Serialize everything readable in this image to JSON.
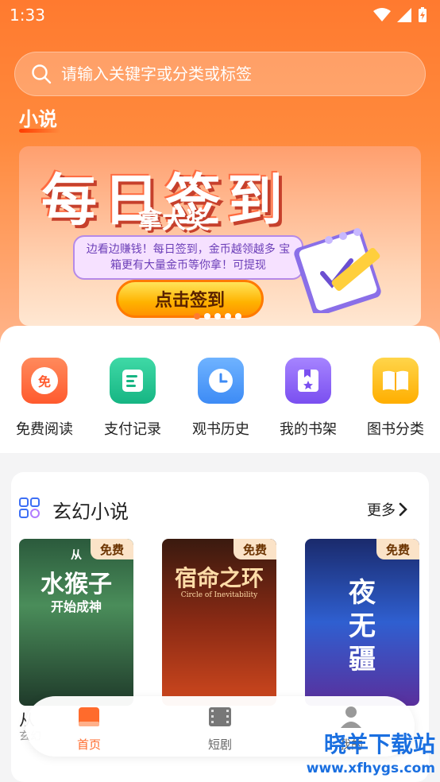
{
  "status_bar": {
    "time": "1:33"
  },
  "search": {
    "placeholder": "请输入关键字或分类或标签"
  },
  "section_tab": "小说",
  "banner": {
    "title": "每日签到",
    "subtitle": "拿大奖",
    "description": "边看边赚钱！每日签到，金币越领越多 宝箱更有大量金币等你拿！可提现",
    "button": "点击签到",
    "slides": 5,
    "active_slide": 1
  },
  "quick_menu": [
    {
      "label": "免费阅读",
      "icon": "free-icon",
      "color": "#ff6b3d",
      "glyph": "免"
    },
    {
      "label": "支付记录",
      "icon": "payment-record-icon",
      "color": "#1bbd8c"
    },
    {
      "label": "观书历史",
      "icon": "history-clock-icon",
      "color": "#4a9bff"
    },
    {
      "label": "我的书架",
      "icon": "bookshelf-icon",
      "color": "#8a5cff"
    },
    {
      "label": "图书分类",
      "icon": "book-category-icon",
      "color": "#ffb300"
    }
  ],
  "category": {
    "title": "玄幻小说",
    "more": "更多",
    "books": [
      {
        "badge": "免费",
        "cover_title": "从水猴子开始成神",
        "cover_line1": "从",
        "cover_line2": "水猴子",
        "cover_line3": "开始成神",
        "caption": "从",
        "sub": "玄幻"
      },
      {
        "badge": "免费",
        "cover_title": "宿命之环",
        "cover_line1": "宿命之环",
        "cover_line2": "Circle of Inevitability",
        "caption": "",
        "sub": ""
      },
      {
        "badge": "免费",
        "cover_title": "夜无疆",
        "cover_line1": "夜",
        "cover_line2": "无",
        "cover_line3": "疆",
        "caption": "",
        "sub": ""
      }
    ]
  },
  "tab_bar": [
    {
      "label": "首页",
      "icon": "home-book-icon",
      "active": true
    },
    {
      "label": "短剧",
      "icon": "film-icon",
      "active": false
    },
    {
      "label": "我的",
      "icon": "user-icon",
      "active": false
    }
  ],
  "watermark": {
    "text": "晓羊下载站",
    "url": "www.xfhygs.com"
  },
  "colors": {
    "accent": "#ff7a2f",
    "tab_active": "#ff6b2c",
    "tab_inactive": "#666666"
  }
}
